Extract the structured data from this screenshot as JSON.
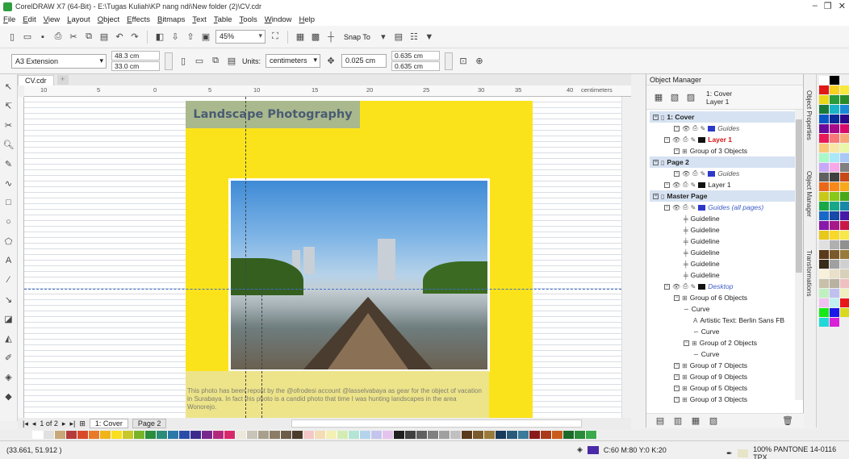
{
  "window": {
    "title": "CorelDRAW X7 (64-Bit) - E:\\Tugas Kuliah\\KP nang ndi\\New folder (2)\\CV.cdr"
  },
  "menu": [
    "File",
    "Edit",
    "View",
    "Layout",
    "Object",
    "Effects",
    "Bitmaps",
    "Text",
    "Table",
    "Tools",
    "Window",
    "Help"
  ],
  "toolbar": {
    "zoom": "45%",
    "snap_to": "Snap To"
  },
  "property_bar": {
    "page_size": "A3 Extension",
    "width": "48.3 cm",
    "height": "33.0 cm",
    "units_label": "Units:",
    "units": "centimeters",
    "nudge": "0.025 cm",
    "dup_x": "0.635 cm",
    "dup_y": "0.635 cm"
  },
  "document_tab": "CV.cdr",
  "ruler": {
    "ticks": [
      "10",
      "5",
      "0",
      "5",
      "10",
      "15",
      "20",
      "25",
      "30",
      "35",
      "40"
    ],
    "unit": "centimeters"
  },
  "canvas": {
    "title": "Landscape Photography",
    "description": "This photo has been repost by the @ofrodesi account @lasselvabaya as gear for the object of vacation in Surabaya. In fact this photo is a candid photo that time I was hunting landscapes in the area Wonorejo."
  },
  "page_nav": {
    "counter": "1 of 2",
    "pages": [
      "1: Cover",
      "Page 2"
    ]
  },
  "status": {
    "coords": "(33.661, 51.912 )",
    "fill": "C:60 M:80 Y:0 K:20",
    "outline": "100% PANTONE 14-0116 TPX",
    "fill_color": "#4a2aa8",
    "outline_color": "#e8e4c8"
  },
  "object_manager": {
    "title": "Object Manager",
    "current_page": "1: Cover",
    "current_layer": "Layer 1",
    "tree": [
      {
        "level": 0,
        "type": "page",
        "label": "1: Cover"
      },
      {
        "level": 2,
        "type": "layer",
        "label": "Guides",
        "style": "grey",
        "color": "#2c38c8"
      },
      {
        "level": 1,
        "type": "layer",
        "label": "Layer 1",
        "style": "red",
        "color": "#111111"
      },
      {
        "level": 2,
        "type": "group",
        "label": "Group of 3 Objects"
      },
      {
        "level": 0,
        "type": "page",
        "label": "Page 2"
      },
      {
        "level": 2,
        "type": "layer",
        "label": "Guides",
        "style": "grey",
        "color": "#2c38c8"
      },
      {
        "level": 1,
        "type": "layer",
        "label": "Layer 1",
        "color": "#111111"
      },
      {
        "level": 0,
        "type": "page",
        "label": "Master Page"
      },
      {
        "level": 1,
        "type": "layer",
        "label": "Guides (all pages)",
        "style": "blue",
        "color": "#2c38c8"
      },
      {
        "level": 3,
        "type": "guide",
        "label": "Guideline"
      },
      {
        "level": 3,
        "type": "guide",
        "label": "Guideline"
      },
      {
        "level": 3,
        "type": "guide",
        "label": "Guideline"
      },
      {
        "level": 3,
        "type": "guide",
        "label": "Guideline"
      },
      {
        "level": 3,
        "type": "guide",
        "label": "Guideline"
      },
      {
        "level": 3,
        "type": "guide",
        "label": "Guideline"
      },
      {
        "level": 1,
        "type": "layer",
        "label": "Desktop",
        "style": "blue",
        "color": "#111111"
      },
      {
        "level": 2,
        "type": "group",
        "label": "Group of 6 Objects"
      },
      {
        "level": 3,
        "type": "curve",
        "label": "Curve"
      },
      {
        "level": 4,
        "type": "text",
        "label": "Artistic Text: Berlin Sans FB"
      },
      {
        "level": 4,
        "type": "curve",
        "label": "Curve"
      },
      {
        "level": 3,
        "type": "group",
        "label": "Group of 2 Objects"
      },
      {
        "level": 4,
        "type": "curve",
        "label": "Curve"
      },
      {
        "level": 2,
        "type": "group",
        "label": "Group of 7 Objects"
      },
      {
        "level": 2,
        "type": "group",
        "label": "Group of 9 Objects"
      },
      {
        "level": 2,
        "type": "group",
        "label": "Group of 5 Objects"
      },
      {
        "level": 2,
        "type": "group",
        "label": "Group of 3 Objects"
      }
    ]
  },
  "docker_tabs": [
    "Object Properties",
    "Object Manager",
    "Transformations"
  ],
  "palette_bottom": [
    "#ffffff",
    "#e0e0e0",
    "#c8a878",
    "#b43c3c",
    "#d84a2a",
    "#e87a2a",
    "#f0b418",
    "#f8e020",
    "#c8c828",
    "#78b428",
    "#2a8c3c",
    "#2a8c78",
    "#2a78a8",
    "#2a4ca8",
    "#3c2a8c",
    "#78288c",
    "#b4287c",
    "#d8286c",
    "#ece8dc",
    "#c8c4b8",
    "#a8a08c",
    "#8c7c64",
    "#6c5c48",
    "#4c3c2c",
    "#f4c8c8",
    "#f4dcb4",
    "#f4f0b4",
    "#d4ecb4",
    "#b4e4d4",
    "#b4d4ec",
    "#c4c4ec",
    "#e4c4ec",
    "#202020",
    "#404040",
    "#606060",
    "#808080",
    "#a0a0a0",
    "#c0c0c0",
    "#5a3a1a",
    "#7a5a2a",
    "#9a7a3a",
    "#1a3a5a",
    "#2a5a7a",
    "#3a7a9a",
    "#8a1a1a",
    "#aa3a1a",
    "#ca5a1a",
    "#1a6a2a",
    "#2a8a3a",
    "#3aaa4a"
  ],
  "palette_right": [
    "#ffffff",
    "#000000",
    "#f0f0f0",
    "#e01818",
    "#f8d020",
    "#f8e83c",
    "#e8d818",
    "#2a9a3a",
    "#2a8a2a",
    "#1a7a3a",
    "#1ab4c8",
    "#1a8ad8",
    "#0a58c8",
    "#0a2a98",
    "#2a0a8a",
    "#6a0a9a",
    "#a80a8a",
    "#d80a6a",
    "#e81858",
    "#f87878",
    "#f8a878",
    "#f8c878",
    "#f8e8a8",
    "#e8f8a8",
    "#a8f8c8",
    "#a8e8f8",
    "#a8c8f8",
    "#c8a8f8",
    "#f8a8e8",
    "#808080",
    "#606060",
    "#404040",
    "#c84818",
    "#e86818",
    "#f88818",
    "#f8a818",
    "#c8c818",
    "#88c818",
    "#48a818",
    "#18a848",
    "#18a888",
    "#1888a8",
    "#1868c8",
    "#1848a8",
    "#4818a8",
    "#8818a8",
    "#a81888",
    "#c81848",
    "#e8c818",
    "#f8d828",
    "#f8e848",
    "#e0e0e0",
    "#b0b0b0",
    "#909090",
    "#5a3a1a",
    "#7a5a2a",
    "#9a7a3a",
    "#3a2a1a",
    "#a0a0a0",
    "#d0d0d0",
    "#f8f0d8",
    "#e8e0c8",
    "#d8d0b8",
    "#c8c0a8",
    "#b8b0a0",
    "#f0c0c0",
    "#c0f0c0",
    "#c0c0f0",
    "#f0f0c0",
    "#f0c0f0",
    "#c0f0f0",
    "#e81818",
    "#18e818",
    "#1818e8",
    "#d8d820",
    "#20d8d8",
    "#d820d8"
  ]
}
